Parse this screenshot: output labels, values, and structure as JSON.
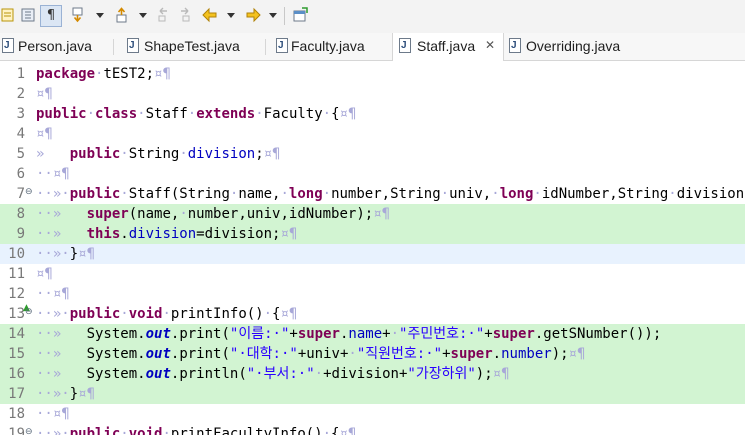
{
  "toolbar": {
    "icons": [
      "toggle-mark-occurrences-icon",
      "toggle-block-selection-icon",
      "show-whitespace-icon",
      "next-annotation-icon",
      "previous-annotation-icon",
      "last-edit-location-icon",
      "back-icon",
      "forward-icon",
      "pin-editor-icon"
    ],
    "pilcrow": "¶"
  },
  "tabs": [
    {
      "label": "Person.java",
      "active": false
    },
    {
      "label": "ShapeTest.java",
      "active": false
    },
    {
      "label": "Faculty.java",
      "active": false
    },
    {
      "label": "Staff.java",
      "active": true,
      "close": "✕"
    },
    {
      "label": "Overriding.java",
      "active": false
    }
  ],
  "file_icon_letter": "J",
  "colors": {
    "keyword": "#7f0055",
    "field": "#0000c0",
    "string": "#2a00ff",
    "whitespace_marker": "#a8a8d8",
    "highlight": "#d2f4d2",
    "current_line": "#e8f2fe"
  },
  "lines": [
    {
      "n": "1",
      "hl": false,
      "segs": [
        [
          "kw",
          "package"
        ],
        [
          "ws",
          "·"
        ],
        [
          "t",
          "tEST2;"
        ],
        [
          "ws",
          "¤¶"
        ]
      ]
    },
    {
      "n": "2",
      "hl": false,
      "segs": [
        [
          "ws",
          "¤¶"
        ]
      ]
    },
    {
      "n": "3",
      "hl": false,
      "segs": [
        [
          "kw",
          "public"
        ],
        [
          "ws",
          "·"
        ],
        [
          "kw",
          "class"
        ],
        [
          "ws",
          "·"
        ],
        [
          "t",
          "Staff"
        ],
        [
          "ws",
          "·"
        ],
        [
          "kw",
          "extends"
        ],
        [
          "ws",
          "·"
        ],
        [
          "t",
          "Faculty"
        ],
        [
          "ws",
          "·"
        ],
        [
          "t",
          "{"
        ],
        [
          "ws",
          "¤¶"
        ]
      ]
    },
    {
      "n": "4",
      "hl": false,
      "segs": [
        [
          "ws",
          "¤¶"
        ]
      ]
    },
    {
      "n": "5",
      "hl": false,
      "segs": [
        [
          "ws",
          "»   "
        ],
        [
          "kw",
          "public"
        ],
        [
          "ws",
          "·"
        ],
        [
          "t",
          "String"
        ],
        [
          "ws",
          "·"
        ],
        [
          "fld",
          "division"
        ],
        [
          "t",
          ";"
        ],
        [
          "ws",
          "¤¶"
        ]
      ]
    },
    {
      "n": "6",
      "hl": false,
      "segs": [
        [
          "ws",
          "··¤¶"
        ]
      ]
    },
    {
      "n": "7",
      "hl": false,
      "fold": "⊖",
      "segs": [
        [
          "ws",
          "··»·"
        ],
        [
          "kw",
          "public"
        ],
        [
          "ws",
          "·"
        ],
        [
          "t",
          "Staff(String"
        ],
        [
          "ws",
          "·"
        ],
        [
          "t",
          "name,"
        ],
        [
          "ws",
          "·"
        ],
        [
          "kw",
          "long"
        ],
        [
          "ws",
          "·"
        ],
        [
          "t",
          "number,String"
        ],
        [
          "ws",
          "·"
        ],
        [
          "t",
          "univ,"
        ],
        [
          "ws",
          "·"
        ],
        [
          "kw",
          "long"
        ],
        [
          "ws",
          "·"
        ],
        [
          "t",
          "idNumber,String"
        ],
        [
          "ws",
          "·"
        ],
        [
          "t",
          "division)"
        ]
      ]
    },
    {
      "n": "8",
      "hl": true,
      "segs": [
        [
          "ws",
          "··»   "
        ],
        [
          "kw",
          "super"
        ],
        [
          "t",
          "(name,"
        ],
        [
          "ws",
          "·"
        ],
        [
          "t",
          "number,univ,idNumber);"
        ],
        [
          "ws",
          "¤¶"
        ]
      ]
    },
    {
      "n": "9",
      "hl": true,
      "segs": [
        [
          "ws",
          "··»   "
        ],
        [
          "kw",
          "this"
        ],
        [
          "t",
          "."
        ],
        [
          "fld",
          "division"
        ],
        [
          "t",
          "=division;"
        ],
        [
          "ws",
          "¤¶"
        ]
      ]
    },
    {
      "n": "10",
      "hl": true,
      "cur": true,
      "segs": [
        [
          "ws",
          "··»·"
        ],
        [
          "t",
          "}"
        ],
        [
          "ws",
          "¤¶"
        ]
      ]
    },
    {
      "n": "11",
      "hl": false,
      "segs": [
        [
          "ws",
          "¤¶"
        ]
      ]
    },
    {
      "n": "12",
      "hl": false,
      "segs": [
        [
          "ws",
          "··¤¶"
        ]
      ]
    },
    {
      "n": "13",
      "hl": false,
      "fold": "⊖",
      "override": "▲",
      "segs": [
        [
          "ws",
          "··»·"
        ],
        [
          "kw",
          "public"
        ],
        [
          "ws",
          "·"
        ],
        [
          "kw",
          "void"
        ],
        [
          "ws",
          "·"
        ],
        [
          "t",
          "printInfo()"
        ],
        [
          "ws",
          "·"
        ],
        [
          "t",
          "{"
        ],
        [
          "ws",
          "¤¶"
        ]
      ]
    },
    {
      "n": "14",
      "hl": true,
      "segs": [
        [
          "ws",
          "··»   "
        ],
        [
          "t",
          "System."
        ],
        [
          "sfld",
          "out"
        ],
        [
          "t",
          ".print("
        ],
        [
          "str",
          "\"이름:·\""
        ],
        [
          "t",
          "+"
        ],
        [
          "kw",
          "super"
        ],
        [
          "t",
          "."
        ],
        [
          "fld",
          "name"
        ],
        [
          "t",
          "+"
        ],
        [
          "ws",
          "·"
        ],
        [
          "str",
          "\"주민번호:·\""
        ],
        [
          "t",
          "+"
        ],
        [
          "kw",
          "super"
        ],
        [
          "t",
          ".getSNumber());"
        ]
      ]
    },
    {
      "n": "15",
      "hl": true,
      "segs": [
        [
          "ws",
          "··»   "
        ],
        [
          "t",
          "System."
        ],
        [
          "sfld",
          "out"
        ],
        [
          "t",
          ".print("
        ],
        [
          "str",
          "\"·대학:·\""
        ],
        [
          "t",
          "+univ+"
        ],
        [
          "ws",
          "·"
        ],
        [
          "str",
          "\"직원번호:·\""
        ],
        [
          "t",
          "+"
        ],
        [
          "kw",
          "super"
        ],
        [
          "t",
          "."
        ],
        [
          "fld",
          "number"
        ],
        [
          "t",
          ");"
        ],
        [
          "ws",
          "¤¶"
        ]
      ]
    },
    {
      "n": "16",
      "hl": true,
      "segs": [
        [
          "ws",
          "··»   "
        ],
        [
          "t",
          "System."
        ],
        [
          "sfld",
          "out"
        ],
        [
          "t",
          ".println("
        ],
        [
          "str",
          "\"·부서:·\""
        ],
        [
          "ws",
          "·"
        ],
        [
          "t",
          "+division+"
        ],
        [
          "str",
          "\"가장하위\""
        ],
        [
          "t",
          ");"
        ],
        [
          "ws",
          "¤¶"
        ]
      ]
    },
    {
      "n": "17",
      "hl": true,
      "segs": [
        [
          "ws",
          "··»·"
        ],
        [
          "t",
          "}"
        ],
        [
          "ws",
          "¤¶"
        ]
      ]
    },
    {
      "n": "18",
      "hl": false,
      "segs": [
        [
          "ws",
          "··¤¶"
        ]
      ]
    },
    {
      "n": "19",
      "hl": false,
      "fold": "⊖",
      "segs": [
        [
          "ws",
          "··»·"
        ],
        [
          "kw",
          "public"
        ],
        [
          "ws",
          "·"
        ],
        [
          "kw",
          "void"
        ],
        [
          "ws",
          "·"
        ],
        [
          "t",
          "printFacultyInfo()"
        ],
        [
          "ws",
          "·"
        ],
        [
          "t",
          "{"
        ],
        [
          "ws",
          "¤¶"
        ]
      ]
    }
  ]
}
